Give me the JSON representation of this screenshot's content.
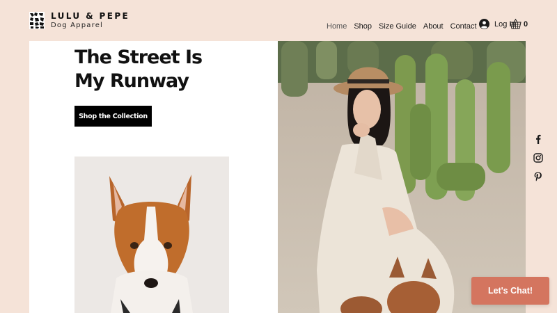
{
  "brand": {
    "name": "LULU & PEPE",
    "tagline": "Dog Apparel"
  },
  "nav": {
    "items": [
      {
        "label": "Home",
        "active": true
      },
      {
        "label": "Shop"
      },
      {
        "label": "Size Guide"
      },
      {
        "label": "About"
      },
      {
        "label": "Contact"
      }
    ]
  },
  "account": {
    "login_label": "Log In",
    "icon": "user-avatar-icon"
  },
  "cart": {
    "count": "0",
    "icon": "shopping-basket-icon"
  },
  "hero": {
    "title_line1": "The Street Is",
    "title_line2": "My Runway",
    "cta_label": "Shop the Collection"
  },
  "images": {
    "dog": "basenji-dog-portrait",
    "model": "woman-in-hat-with-cactus-and-dog"
  },
  "social": {
    "icons": [
      "facebook-icon",
      "instagram-icon",
      "pinterest-icon"
    ]
  },
  "chat": {
    "label": "Let's Chat!"
  },
  "colors": {
    "page_bg": "#f5e3d8",
    "panel_bg": "#ffffff",
    "button_bg": "#000000",
    "chat_bg": "#d4755f",
    "text": "#111111"
  }
}
